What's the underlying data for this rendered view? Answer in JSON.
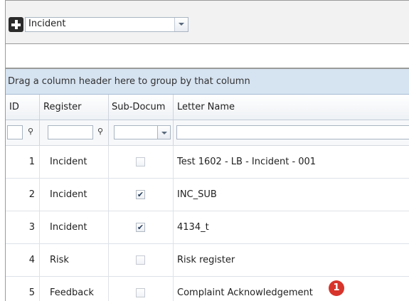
{
  "toolbar": {
    "add_icon": "plus-icon",
    "register_select": {
      "value": "Incident"
    }
  },
  "grid": {
    "group_panel_text": "Drag a column header here to group by that column",
    "columns": [
      "ID",
      "Register",
      "Sub-Docum",
      "Letter Name"
    ],
    "rows": [
      {
        "id": "1",
        "register": "Incident",
        "sub_document": false,
        "letter_name": "Test 1602 - LB - Incident - 001"
      },
      {
        "id": "2",
        "register": "Incident",
        "sub_document": true,
        "letter_name": "INC_SUB"
      },
      {
        "id": "3",
        "register": "Incident",
        "sub_document": true,
        "letter_name": "4134_t"
      },
      {
        "id": "4",
        "register": "Risk",
        "sub_document": false,
        "letter_name": "Risk register"
      },
      {
        "id": "5",
        "register": "Feedback",
        "sub_document": false,
        "letter_name": "Complaint Acknowledgement"
      }
    ]
  },
  "annotation": {
    "badge": "1",
    "color": "#d7342b"
  },
  "colors": {
    "group_panel_bg": "#d6e3f1",
    "toolbar_bg": "#f2f2f2"
  }
}
